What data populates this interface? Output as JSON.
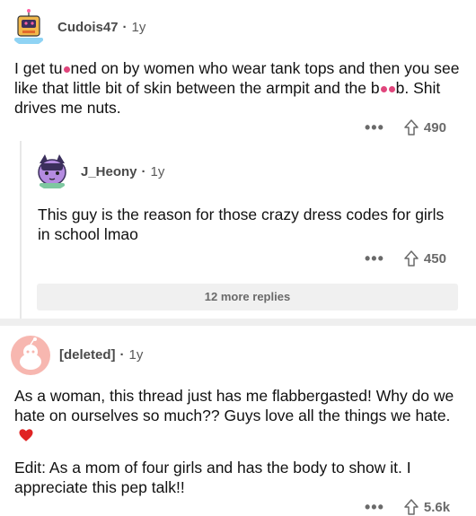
{
  "comments": [
    {
      "username": "Cudois47",
      "age": "1y",
      "text_before": "I get tu",
      "text_after": "ned on by women who wear tank tops and then you see like that little bit of skin between the armpit and the b",
      "text_after2": "b. Shit drives me nuts.",
      "votes": "490",
      "avatar": "robot-avatar-icon"
    },
    {
      "username": "J_Heony",
      "age": "1y",
      "text": "This guy is the reason for those crazy dress codes for girls in school lmao",
      "votes": "450",
      "avatar": "cat-avatar-icon"
    },
    {
      "username": "[deleted]",
      "age": "1y",
      "paragraph1": "As a woman, this thread just has me flabbergasted! Why do we hate on ourselves so much?? Guys love all the things we hate.",
      "paragraph2": "Edit: As a mom of four girls and has the body to show it. I appreciate this pep talk!!",
      "votes": "5.6k",
      "avatar": "deleted-user-icon"
    }
  ],
  "more_replies": "12 more replies",
  "colors": {
    "censor": "#e0467c",
    "heart": "#e02424",
    "deleted_avatar": "#f7b7b0"
  }
}
